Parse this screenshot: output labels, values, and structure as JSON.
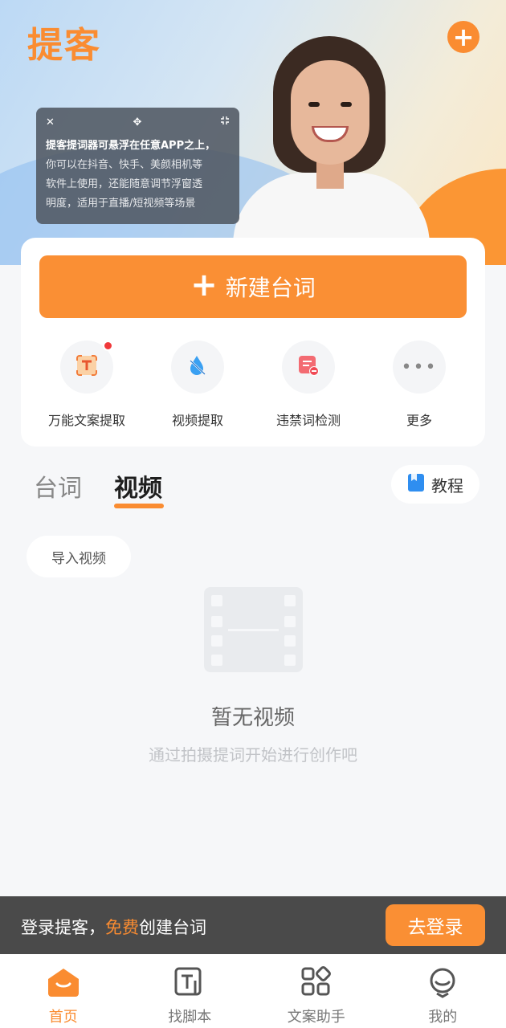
{
  "app": {
    "logo_text": "提客",
    "accent_color": "#fa8c31"
  },
  "hero": {
    "add_icon": "plus-circle-icon",
    "floating_card": {
      "close_icon": "close-icon",
      "move_icon": "move-icon",
      "shrink_icon": "shrink-icon",
      "line1": "提客提词器可悬浮在任意APP之上，",
      "line2": "你可以在抖音、快手、美颜相机等",
      "line3": "软件上使用，还能随意调节浮窗透",
      "line4": "明度，适用于直播/短视频等场景"
    }
  },
  "actions": {
    "new_script_label": "新建台词",
    "tools": [
      {
        "label": "万能文案提取",
        "icon": "text-extract-icon",
        "badge": true
      },
      {
        "label": "视频提取",
        "icon": "droplet-icon",
        "badge": false
      },
      {
        "label": "违禁词检测",
        "icon": "forbidden-word-icon",
        "badge": false
      },
      {
        "label": "更多",
        "icon": "more-icon",
        "badge": false
      }
    ]
  },
  "tabs": [
    {
      "label": "台词",
      "active": false
    },
    {
      "label": "视频",
      "active": true
    }
  ],
  "tutorial_label": "教程",
  "import_label": "导入视频",
  "empty_state": {
    "icon": "film-icon",
    "title": "暂无视频",
    "subtitle": "通过拍摄提词开始进行创作吧"
  },
  "login_banner": {
    "text_before": "登录提客，",
    "text_highlight": "免费",
    "text_after": "创建台词",
    "button_label": "去登录"
  },
  "bottom_nav": [
    {
      "label": "首页",
      "icon": "home-icon",
      "active": true
    },
    {
      "label": "找脚本",
      "icon": "script-icon",
      "active": false
    },
    {
      "label": "文案助手",
      "icon": "apps-icon",
      "active": false
    },
    {
      "label": "我的",
      "icon": "profile-icon",
      "active": false
    }
  ]
}
